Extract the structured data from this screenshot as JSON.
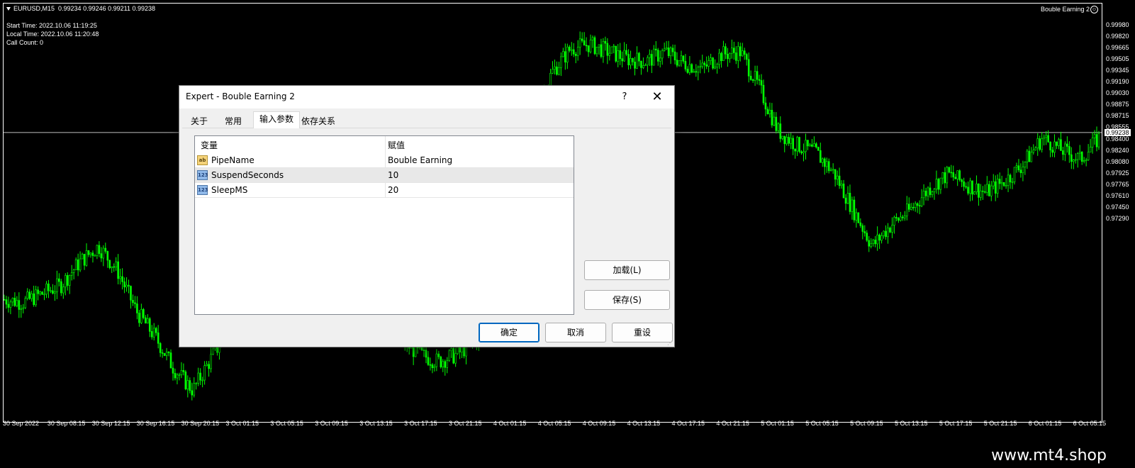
{
  "chart": {
    "header_symbol": "EURUSD,M15",
    "header_ohlc": "0.99234 0.99246 0.99211 0.99238",
    "status_lines": [
      "Start Time: 2022.10.06 11:19:25",
      "Local Time: 2022.10.06 11:20:48",
      "Call Count: 0"
    ],
    "ea_name": "Bouble Earning 2",
    "smiley_icon": "smiley-icon",
    "candle_color": "#00ff00",
    "background_color": "#000000",
    "price_labels": [
      "0.99980",
      "0.99820",
      "0.99665",
      "0.99505",
      "0.99345",
      "0.99190",
      "0.99030",
      "0.98875",
      "0.98715",
      "0.98555",
      "0.98400",
      "0.98240",
      "0.98080",
      "0.97925",
      "0.97765",
      "0.97610",
      "0.97450",
      "0.97290"
    ],
    "current_price": "0.99238",
    "time_labels": [
      "30 Sep 2022",
      "30 Sep 08:15",
      "30 Sep 12:15",
      "30 Sep 16:15",
      "30 Sep 20:15",
      "3 Oct 01:15",
      "3 Oct 05:15",
      "3 Oct 09:15",
      "3 Oct 13:15",
      "3 Oct 17:15",
      "3 Oct 21:15",
      "4 Oct 01:15",
      "4 Oct 05:15",
      "4 Oct 09:15",
      "4 Oct 13:15",
      "4 Oct 17:15",
      "4 Oct 21:15",
      "5 Oct 01:15",
      "5 Oct 05:15",
      "5 Oct 09:15",
      "5 Oct 13:15",
      "5 Oct 17:15",
      "5 Oct 21:15",
      "6 Oct 01:15",
      "6 Oct 05:15"
    ],
    "close_path_prices": [
      0.9808,
      0.9806,
      0.9812,
      0.9818,
      0.9834,
      0.9845,
      0.9828,
      0.98,
      0.9782,
      0.976,
      0.9745,
      0.9768,
      0.979,
      0.98,
      0.9807,
      0.9815,
      0.983,
      0.9835,
      0.9825,
      0.98,
      0.979,
      0.978,
      0.977,
      0.9765,
      0.977,
      0.978,
      0.9812,
      0.988,
      0.993,
      0.9965,
      0.9982,
      0.9985,
      0.998,
      0.9975,
      0.9973,
      0.998,
      0.9972,
      0.9968,
      0.9978,
      0.998,
      0.9955,
      0.9925,
      0.9915,
      0.991,
      0.9895,
      0.987,
      0.9845,
      0.986,
      0.987,
      0.9885,
      0.9895,
      0.9888,
      0.9882,
      0.989,
      0.9902,
      0.992,
      0.9912,
      0.9905,
      0.992
    ]
  },
  "dialog": {
    "title": "Expert - Bouble Earning 2",
    "help_label": "?",
    "close_label": "✕",
    "tabs": [
      {
        "label": "关于",
        "active": false
      },
      {
        "label": "常用",
        "active": false
      },
      {
        "label": "输入参数",
        "active": true
      },
      {
        "label": "依存关系",
        "active": false
      }
    ],
    "table": {
      "col_variable": "变量",
      "col_value": "赋值",
      "rows": [
        {
          "icon": "ab",
          "name": "PipeName",
          "value": "Bouble Earning"
        },
        {
          "icon": "123",
          "name": "SuspendSeconds",
          "value": "10"
        },
        {
          "icon": "123",
          "name": "SleepMS",
          "value": "20"
        }
      ]
    },
    "load_label": "加载(L)",
    "save_label": "保存(S)",
    "ok_label": "确定",
    "cancel_label": "取消",
    "reset_label": "重设",
    "accent_color": "#0067c0"
  },
  "footer": {
    "watermark": "www.mt4.shop"
  }
}
